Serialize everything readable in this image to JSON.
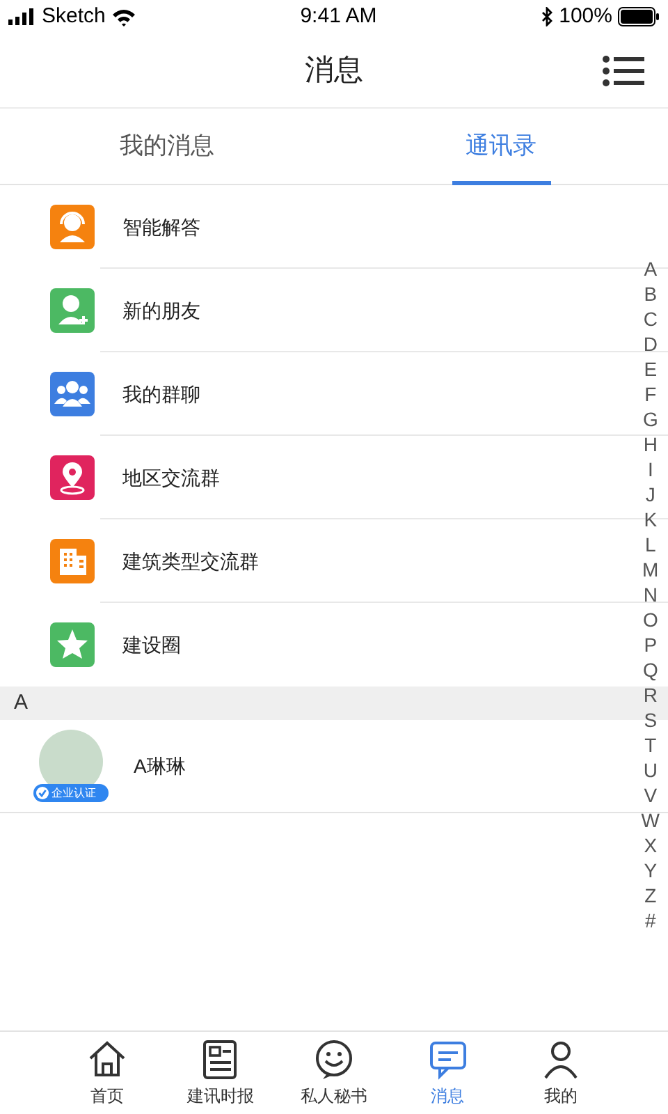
{
  "status_bar": {
    "carrier": "Sketch",
    "time": "9:41 AM",
    "battery": "100%"
  },
  "header": {
    "title": "消息"
  },
  "tabs": [
    {
      "label": "我的消息",
      "selected": false
    },
    {
      "label": "通讯录",
      "selected": true
    }
  ],
  "entries": [
    {
      "label": "智能解答",
      "kind": "headset",
      "color": "#f5820f"
    },
    {
      "label": "新的朋友",
      "kind": "user-plus",
      "color": "#4cb963"
    },
    {
      "label": "我的群聊",
      "kind": "group",
      "color": "#3d7ee0"
    },
    {
      "label": "地区交流群",
      "kind": "location",
      "color": "#e0245e"
    },
    {
      "label": "建筑类型交流群",
      "kind": "building",
      "color": "#f5820f"
    },
    {
      "label": "建设圈",
      "kind": "star",
      "color": "#4cb963"
    }
  ],
  "sections": [
    {
      "header": "A",
      "contacts": [
        {
          "name": "A琳琳",
          "badge": "企业认证"
        }
      ]
    }
  ],
  "index": [
    "A",
    "B",
    "C",
    "D",
    "E",
    "F",
    "G",
    "H",
    "I",
    "J",
    "K",
    "L",
    "M",
    "N",
    "O",
    "P",
    "Q",
    "R",
    "S",
    "T",
    "U",
    "V",
    "W",
    "X",
    "Y",
    "Z",
    "#"
  ],
  "bottom_nav": [
    {
      "label": "首页",
      "kind": "home",
      "selected": false
    },
    {
      "label": "建讯时报",
      "kind": "news",
      "selected": false
    },
    {
      "label": "私人秘书",
      "kind": "smile",
      "selected": false
    },
    {
      "label": "消息",
      "kind": "chat",
      "selected": true
    },
    {
      "label": "我的",
      "kind": "person",
      "selected": false
    }
  ]
}
